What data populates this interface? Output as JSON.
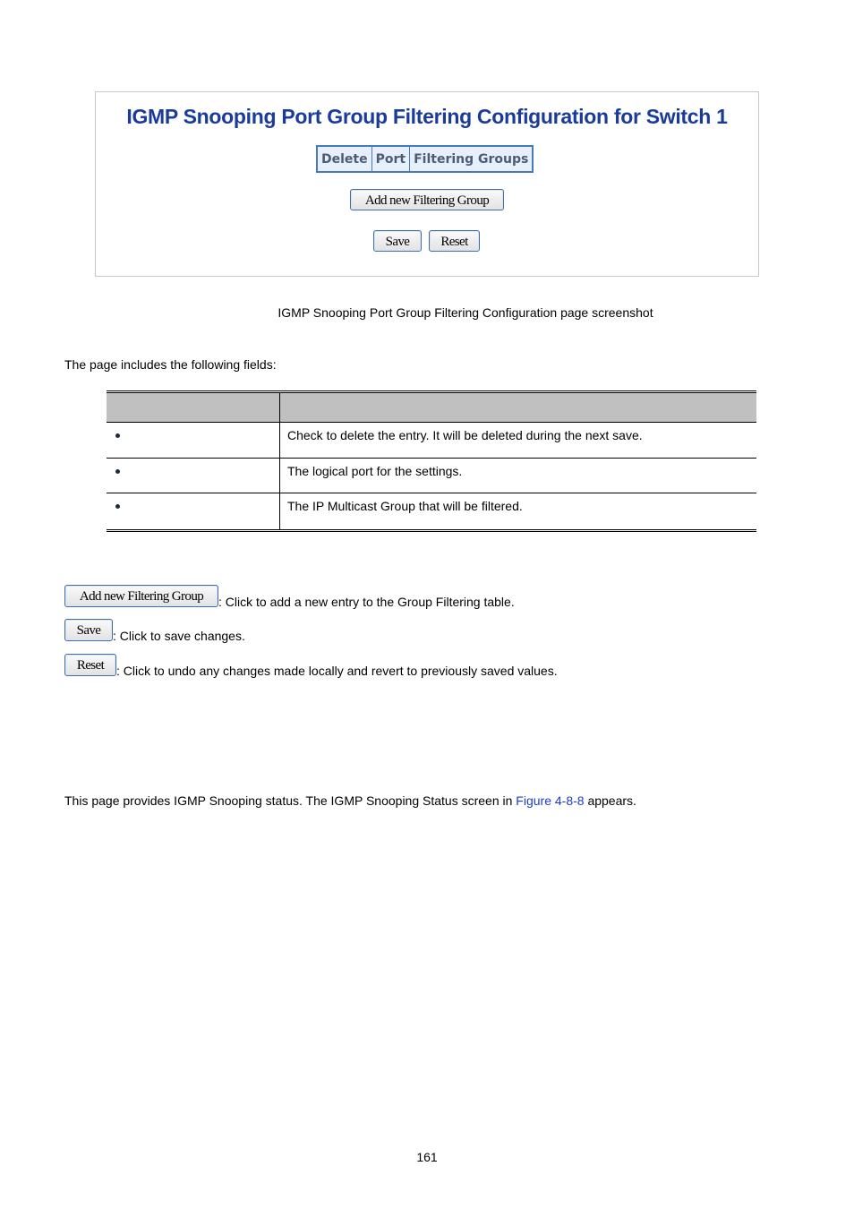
{
  "screenshot": {
    "title": "IGMP Snooping Port Group Filtering Configuration for Switch 1",
    "table_headers": [
      "Delete",
      "Port",
      "Filtering Groups"
    ],
    "add_button_label": "Add new Filtering Group",
    "save_button_label": "Save",
    "reset_button_label": "Reset",
    "colors": {
      "title": "#1a3b9a",
      "header_bg": "#e6f0fc",
      "header_border": "#4a7ab6"
    }
  },
  "caption": "IGMP Snooping Port Group Filtering Configuration page screenshot",
  "intro": "The page includes the following fields:",
  "fields_table": {
    "headers": [
      "",
      ""
    ],
    "rows": [
      {
        "label": "",
        "description": "Check to delete the entry. It will be deleted during the next save."
      },
      {
        "label": "",
        "description": "The logical port for the settings."
      },
      {
        "label": "",
        "description": "The IP Multicast Group that will be filtered."
      }
    ]
  },
  "buttons_help": [
    {
      "label": "Add new Filtering Group",
      "text": ": Click to add a new entry to the Group Filtering table."
    },
    {
      "label": "Save",
      "text": ": Click to save changes."
    },
    {
      "label": "Reset",
      "text": ": Click to undo any changes made locally and revert to previously saved values."
    }
  ],
  "status_para": {
    "before": "This page provides IGMP Snooping status. The IGMP Snooping Status screen in ",
    "link": "Figure 4-8-8",
    "after": " appears."
  },
  "page_number": "161"
}
